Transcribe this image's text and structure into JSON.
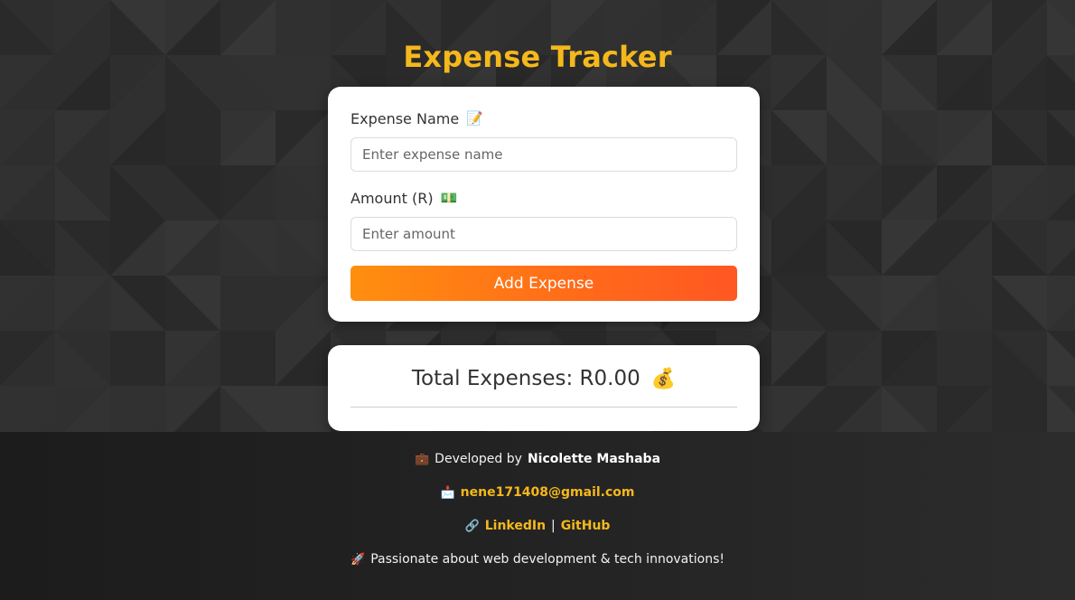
{
  "header": {
    "title": "Expense Tracker"
  },
  "form": {
    "name_label": "Expense Name",
    "name_icon": "memo-icon",
    "name_emoji": "📝",
    "name_placeholder": "Enter expense name",
    "name_value": "",
    "amount_label": "Amount (R)",
    "amount_icon": "banknote-icon",
    "amount_emoji": "💵",
    "amount_placeholder": "Enter amount",
    "amount_value": "",
    "submit_label": "Add Expense"
  },
  "summary": {
    "total_text": "Total Expenses: R0.00",
    "total_icon": "money-bag-icon",
    "total_emoji": "💰"
  },
  "footer": {
    "dev_emoji": "💼",
    "dev_prefix": "Developed by",
    "dev_name": "Nicolette Mashaba",
    "email_emoji": "📩",
    "email": "nene171408@gmail.com",
    "links_emoji": "🔗",
    "linkedin": "LinkedIn",
    "separator": "|",
    "github": "GitHub",
    "tagline_emoji": "🚀",
    "tagline": "Passionate about web development & tech innovations!"
  },
  "colors": {
    "accent": "#f5b81c",
    "button_start": "#ff8f0f",
    "button_end": "#ff5722",
    "background": "#2b2b2b",
    "card": "#ffffff"
  }
}
